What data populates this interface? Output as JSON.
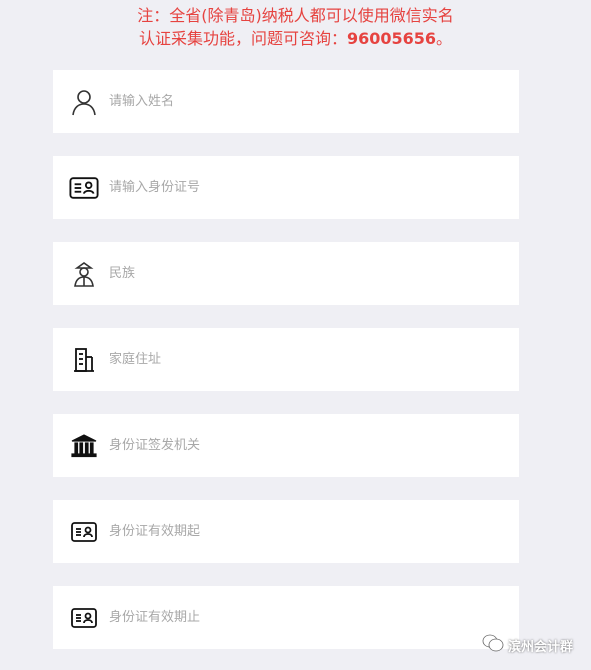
{
  "notice": {
    "line1": "注：全省(除青岛)纳税人都可以使用微信实名",
    "line2_prefix": "认证采集功能，问题可咨询：",
    "phone": "96005656",
    "line2_suffix": "。"
  },
  "fields": [
    {
      "name": "name",
      "icon": "person-icon",
      "placeholder": "请输入姓名"
    },
    {
      "name": "id-number",
      "icon": "id-card-icon",
      "placeholder": "请输入身份证号"
    },
    {
      "name": "ethnicity",
      "icon": "ethnic-person-icon",
      "placeholder": "民族"
    },
    {
      "name": "home-address",
      "icon": "building-icon",
      "placeholder": "家庭住址"
    },
    {
      "name": "issuing-authority",
      "icon": "government-building-icon",
      "placeholder": "身份证签发机关"
    },
    {
      "name": "valid-from",
      "icon": "id-card-icon",
      "placeholder": "身份证有效期起"
    },
    {
      "name": "valid-to",
      "icon": "id-card-icon",
      "placeholder": "身份证有效期止"
    }
  ],
  "watermark": {
    "text": "滨州会计群",
    "icon": "wechat-account-icon"
  }
}
